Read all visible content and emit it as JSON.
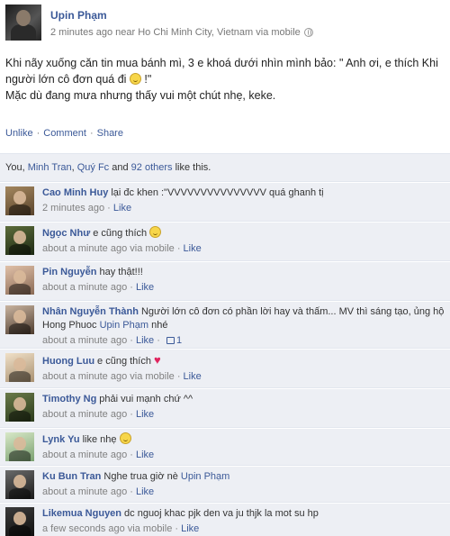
{
  "post": {
    "author": "Upin Phạm",
    "meta": "2 minutes ago near Ho Chi Minh City, Vietnam via mobile",
    "status_line1": "Khi nãy xuống căn tin mua bánh mì, 3 e khoá dưới nhìn mình bảo: \" Anh ơi, e thích Khi người lớn cô đơn quá đi",
    "status_line1_end": " !\"",
    "status_line2": "Mặc dù đang mưa nhưng thấy vui một chút nhẹ, keke."
  },
  "actions": {
    "unlike": "Unlike",
    "comment": "Comment",
    "share": "Share",
    "separator": "·"
  },
  "likes": {
    "prefix": "You, ",
    "name1": "Minh Tran",
    "comma": ", ",
    "name2": "Quý Fc",
    "and": " and ",
    "others": "92 others",
    "suffix": " like this."
  },
  "comments": [
    {
      "name": "Cao Minh Huy",
      "text": "lại đc khen :\"VVVVVVVVVVVVVVV quá ghanh tị",
      "time": "2 minutes ago",
      "via": "",
      "like": "Like",
      "likes_count": ""
    },
    {
      "name": "Ngọc Như",
      "text": "e cũng thích",
      "time": "about a minute ago",
      "via": " via mobile",
      "like": "Like",
      "likes_count": ""
    },
    {
      "name": "Pin Nguyễn",
      "text": "hay thật!!!",
      "time": "about a minute ago",
      "via": "",
      "like": "Like",
      "likes_count": ""
    },
    {
      "name": "Nhân Nguyễn Thành",
      "text": "Người lớn cô đơn có phần lời hay và thấm... MV thì sáng tạo, ủng hộ Hong Phuoc",
      "mention": "Upin Phạm",
      "text_after": " nhé",
      "time": "about a minute ago",
      "via": "",
      "like": "Like",
      "likes_count": "1"
    },
    {
      "name": "Huong Luu",
      "text": "e cũng thích",
      "time": "about a minute ago",
      "via": " via mobile",
      "like": "Like",
      "likes_count": ""
    },
    {
      "name": "Timothy Ng",
      "text": "phải vui mạnh chứ ^^",
      "time": "about a minute ago",
      "via": "",
      "like": "Like",
      "likes_count": ""
    },
    {
      "name": "Lynk Yu",
      "text": "like nhẹ",
      "time": "about a minute ago",
      "via": "",
      "like": "Like",
      "likes_count": ""
    },
    {
      "name": "Ku Bun Tran",
      "text": "Nghe trua giờ nè",
      "mention": "Upin Phạm",
      "time": "about a minute ago",
      "via": "",
      "like": "Like",
      "likes_count": ""
    },
    {
      "name": "Likemua Nguyen",
      "text": "dc nguoj khac pjk den va ju thjk la mot su hp",
      "time": "a few seconds ago",
      "via": " via mobile",
      "like": "Like",
      "likes_count": ""
    }
  ],
  "colors": {
    "link": "#3b5998",
    "panel": "#edeff4",
    "meta": "#808080"
  }
}
